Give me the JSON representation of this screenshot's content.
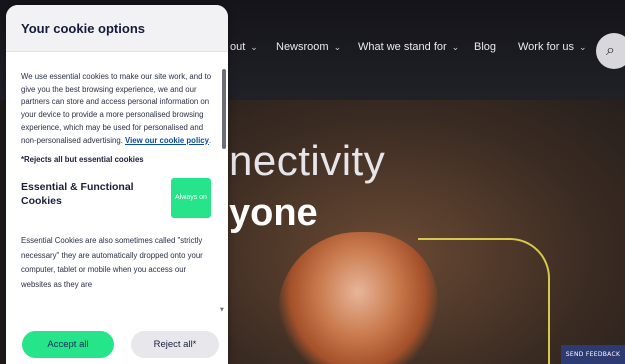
{
  "site": {
    "nav": [
      {
        "label": "out",
        "chevron": "⌄"
      },
      {
        "label": "Newsroom",
        "chevron": "⌄"
      },
      {
        "label": "What we stand for",
        "chevron": "⌄"
      },
      {
        "label": "Blog",
        "chevron": ""
      },
      {
        "label": "Work for us",
        "chevron": "⌄"
      }
    ],
    "search_icon": "search-icon",
    "hero_line1": "nectivity",
    "hero_line2": "yone",
    "feedback_label": "SEND FEEDBACK"
  },
  "dialog": {
    "title": "Your cookie options",
    "intro_text": "We use essential cookies to make our site work, and to give you the best browsing experience, we and our partners can store and access personal information on your device to provide a more personalised browsing experience, which may be used for personalised and non-personalised advertising.",
    "policy_link": "View our cookie policy",
    "rejects_note": "*Rejects all but essential cookies",
    "section_title": "Essential & Functional Cookies",
    "always_on_label": "Always on",
    "section_desc": "Essential Cookies are also sometimes called \"strictly necessary\" they are automatically dropped onto your computer, tablet or mobile when you access our websites as they are",
    "accept_label": "Accept all",
    "reject_label": "Reject all*",
    "colors": {
      "accent": "#26e48a",
      "navy": "#151b3a",
      "link": "#0b4aa8"
    }
  }
}
